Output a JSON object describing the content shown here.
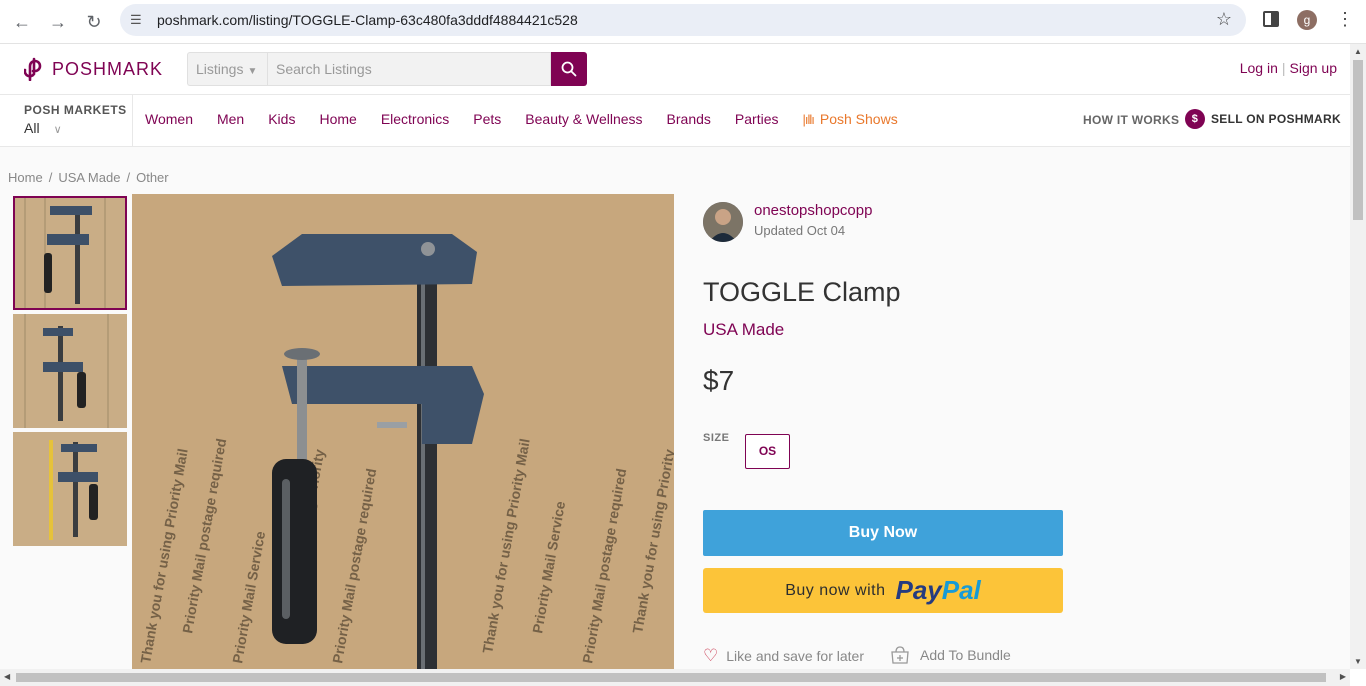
{
  "browser": {
    "url": "poshmark.com/listing/TOGGLE-Clamp-63c480fa3dddf4884421c528",
    "profile_initial": "g"
  },
  "header": {
    "logo_text": "POSHMARK",
    "search_category": "Listings",
    "search_placeholder": "Search Listings",
    "login": "Log in",
    "signup": "Sign up"
  },
  "nav": {
    "markets_title": "POSH MARKETS",
    "markets_value": "All",
    "categories": [
      "Women",
      "Men",
      "Kids",
      "Home",
      "Electronics",
      "Pets",
      "Beauty & Wellness",
      "Brands",
      "Parties"
    ],
    "posh_shows": "Posh Shows",
    "how_it_works": "HOW IT WORKS",
    "sell": "SELL ON POSHMARK"
  },
  "breadcrumb": [
    "Home",
    "USA Made",
    "Other"
  ],
  "listing": {
    "seller_name": "onestopshopcopp",
    "updated": "Updated Oct 04",
    "title": "TOGGLE Clamp",
    "brand": "USA Made",
    "price": "$7",
    "size_label": "SIZE",
    "size_value": "OS",
    "buy_now": "Buy Now",
    "paypal_prefix": "Buy now with",
    "paypal_brand_1": "Pay",
    "paypal_brand_2": "Pal",
    "like": "Like and save for later",
    "bundle": "Add To Bundle"
  },
  "colors": {
    "brand": "#7f0353",
    "buy_button": "#3fa2da",
    "paypal_bg": "#fcc439",
    "posh_shows": "#e9782c"
  }
}
